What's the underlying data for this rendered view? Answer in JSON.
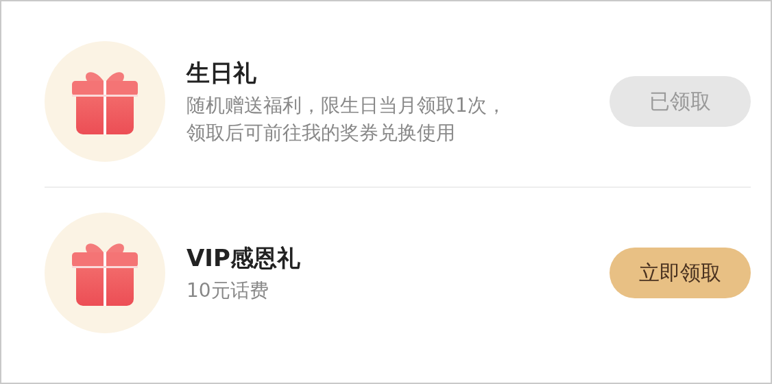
{
  "gifts": [
    {
      "title": "生日礼",
      "description": [
        "随机赠送福利，限生日当月领取1次，",
        "领取后可前往我的奖券兑换使用"
      ],
      "button": {
        "label": "已领取",
        "claimed": true
      }
    },
    {
      "title": "VIP感恩礼",
      "description": [
        "10元话费"
      ],
      "button": {
        "label": "立即领取",
        "claimed": false
      }
    }
  ]
}
